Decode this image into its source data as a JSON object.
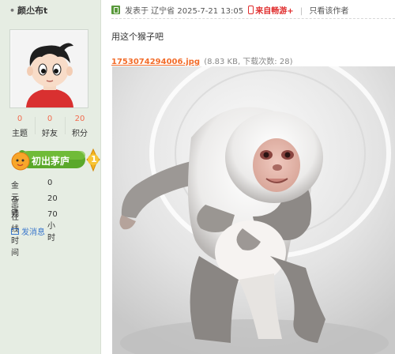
{
  "user": {
    "name": "颜尐布t",
    "stats": [
      {
        "value": "0",
        "label": "主题"
      },
      {
        "value": "0",
        "label": "好友"
      },
      {
        "value": "20",
        "label": "积分"
      }
    ],
    "rank_badge": "初出茅庐",
    "rank_level": "1",
    "info": [
      {
        "key": "金元宝",
        "value": "0"
      },
      {
        "key": "金钱",
        "value": "20"
      },
      {
        "key": "在线时间",
        "value": "70 小时"
      }
    ],
    "message_link": "发消息"
  },
  "post": {
    "posted_label": "发表于 辽宁省 2025-7-21 13:05",
    "source": "来自畅游+",
    "separator": "|",
    "only_author": "只看该作者",
    "text": "用这个猴子吧",
    "attachment": {
      "filename": "1753074294006.jpg",
      "info": "(8.83 KB, 下载次数: 28)"
    }
  },
  "colors": {
    "sidebar_bg": "#e6ede3",
    "accent_orange": "#f26c2a",
    "source_red": "#e02c2c",
    "link_blue": "#3a77cc"
  }
}
